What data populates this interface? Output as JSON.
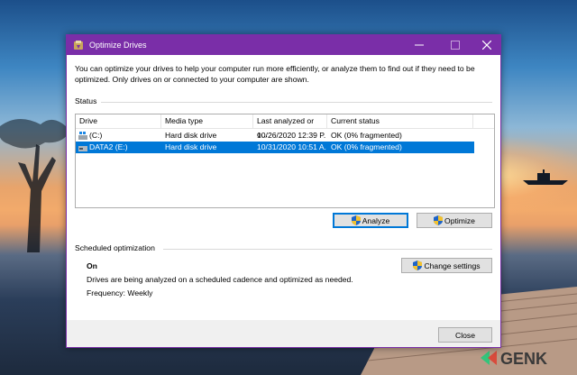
{
  "window": {
    "title": "Optimize Drives",
    "intro": "You can optimize your drives to help your computer run more efficiently, or analyze them to find out if they need to be optimized. Only drives on or connected to your computer are shown."
  },
  "status": {
    "header": "Status",
    "columns": [
      "Drive",
      "Media type",
      "Last analyzed or o...",
      "Current status"
    ],
    "rows": [
      {
        "drive": "(C:)",
        "media": "Hard disk drive",
        "last": "10/26/2020 12:39 P...",
        "status": "OK (0% fragmented)",
        "selected": false
      },
      {
        "drive": "DATA2 (E:)",
        "media": "Hard disk drive",
        "last": "10/31/2020 10:51 A...",
        "status": "OK (0% fragmented)",
        "selected": true
      }
    ],
    "analyze_label": "Analyze",
    "optimize_label": "Optimize"
  },
  "scheduled": {
    "header": "Scheduled optimization",
    "state": "On",
    "description": "Drives are being analyzed on a scheduled cadence and optimized as needed.",
    "frequency": "Frequency: Weekly",
    "change_label": "Change settings"
  },
  "footer": {
    "close_label": "Close"
  },
  "watermark": {
    "brand": "GENK"
  },
  "colors": {
    "titlebar": "#7a2ea8",
    "selection": "#0078d7"
  }
}
